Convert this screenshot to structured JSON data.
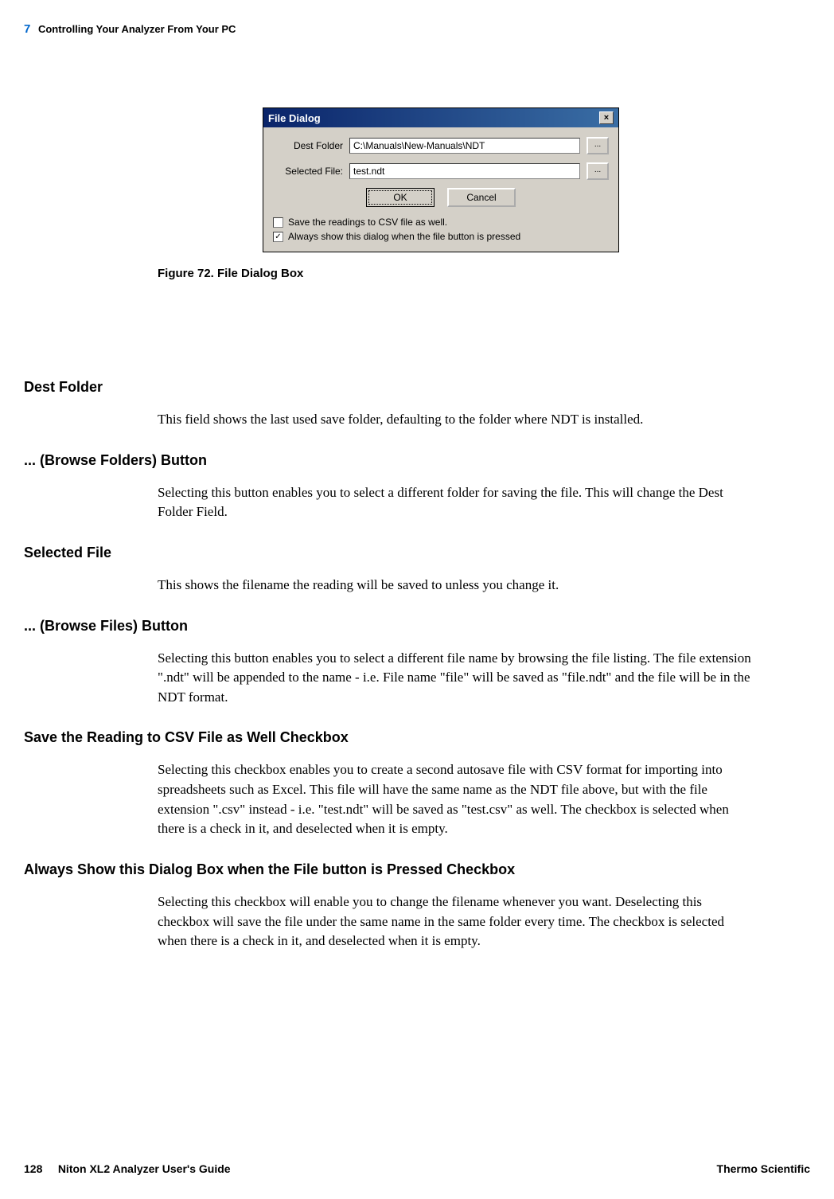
{
  "header": {
    "chapter_num": "7",
    "chapter_title": "Controlling Your Analyzer From Your PC"
  },
  "dialog": {
    "title": "File Dialog",
    "close_glyph": "×",
    "dest_folder_label": "Dest Folder",
    "dest_folder_value": "C:\\Manuals\\New-Manuals\\NDT",
    "selected_file_label": "Selected File:",
    "selected_file_value": "test.ndt",
    "browse_label": "...",
    "ok_label": "OK",
    "cancel_label": "Cancel",
    "csv_checkbox_label": "Save the readings to CSV file as well.",
    "csv_checked": "",
    "always_checkbox_label": "Always show this dialog when the file button is pressed",
    "always_checked": "✓"
  },
  "figure": {
    "caption": "Figure 72.   File Dialog Box"
  },
  "sections": {
    "s1": {
      "heading": "Dest Folder",
      "body": "This field shows the last used save folder, defaulting to the folder where NDT is installed."
    },
    "s2": {
      "heading": "... (Browse Folders) Button",
      "body": "Selecting this button enables you to select a different folder for saving the file. This will change the Dest Folder Field."
    },
    "s3": {
      "heading": "Selected File",
      "body": "This shows the filename the reading will be saved to unless you change it."
    },
    "s4": {
      "heading": "... (Browse Files) Button",
      "body": "Selecting this button enables you to select a different file name by browsing the file listing. The file extension \".ndt\" will be appended to the name - i.e. File name \"file\" will be saved as \"file.ndt\" and the file will be in the NDT format."
    },
    "s5": {
      "heading": "Save the Reading to CSV File as Well Checkbox",
      "body": "Selecting this checkbox enables you to create a second autosave file with CSV format for importing into spreadsheets such as Excel. This file will have the same name as the NDT file above, but with the file extension \".csv\" instead - i.e. \"test.ndt\" will be saved as \"test.csv\" as well. The checkbox is selected when there is a check in it, and deselected when it is empty."
    },
    "s6": {
      "heading": "Always Show this Dialog Box when the File button is Pressed Checkbox",
      "body": "Selecting this checkbox will enable you to change the filename whenever you want. Deselecting this checkbox will save the file under the same name in the same folder every time. The checkbox is selected when there is a check in it, and deselected when it is empty."
    }
  },
  "footer": {
    "page_num": "128",
    "guide_title": "Niton XL2 Analyzer User's Guide",
    "company": "Thermo Scientific"
  }
}
